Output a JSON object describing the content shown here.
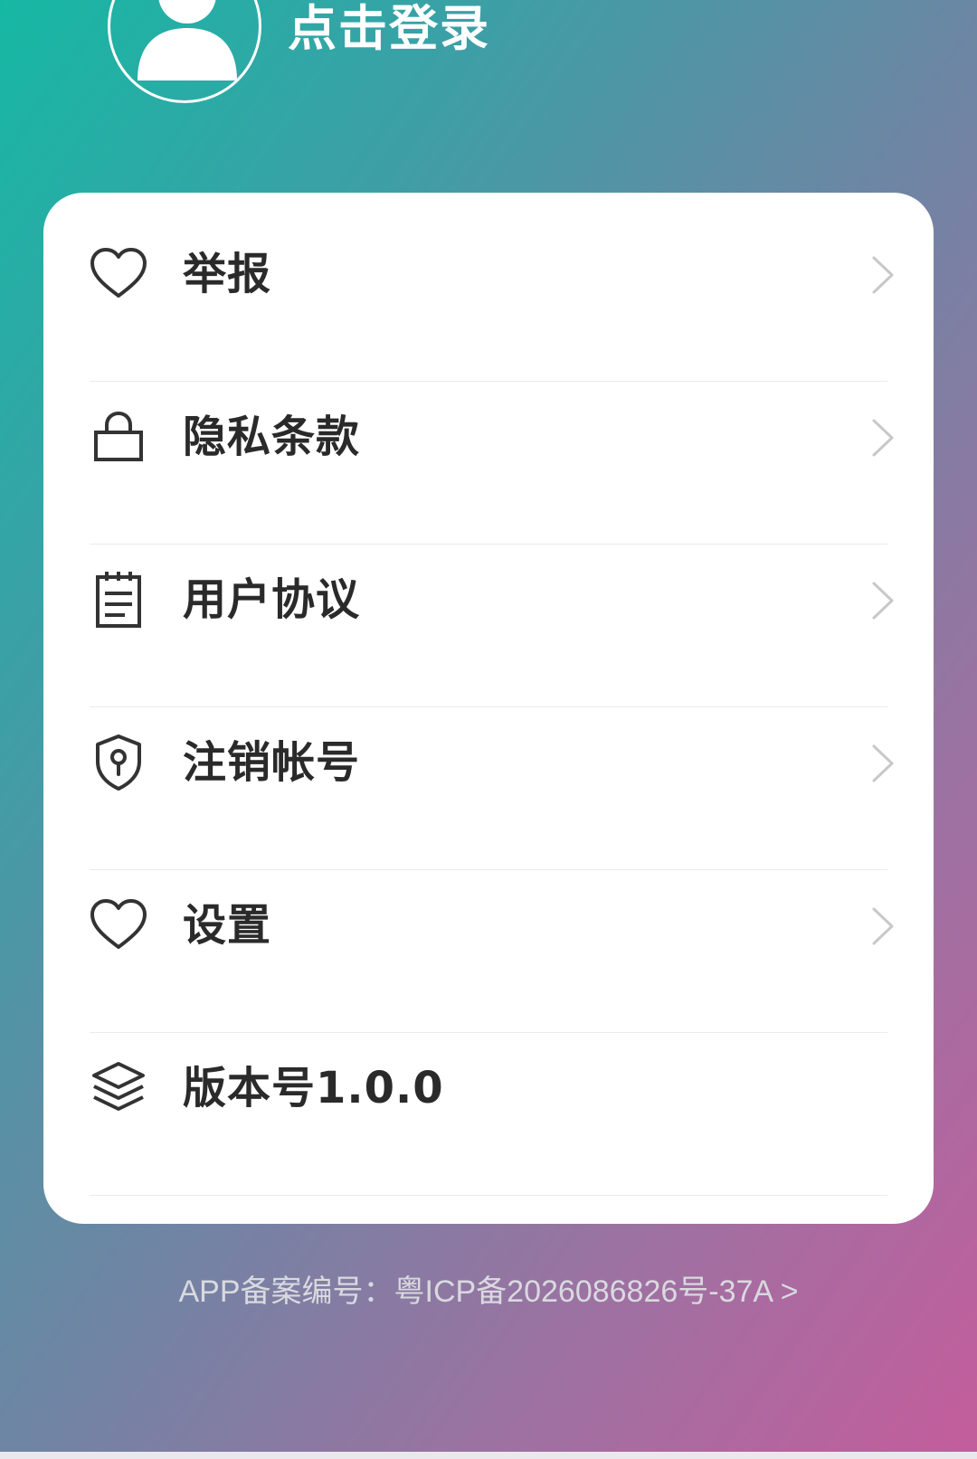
{
  "header": {
    "login_label": "点击登录",
    "avatar_icon": "user-avatar-icon"
  },
  "menu": {
    "items": [
      {
        "label": "举报",
        "icon": "heart-icon",
        "has_arrow": true
      },
      {
        "label": "隐私条款",
        "icon": "lock-icon",
        "has_arrow": true
      },
      {
        "label": "用户协议",
        "icon": "notepad-icon",
        "has_arrow": true
      },
      {
        "label": "注销帐号",
        "icon": "shield-keyhole-icon",
        "has_arrow": true
      },
      {
        "label": "设置",
        "icon": "heart-icon",
        "has_arrow": true
      },
      {
        "label": "版本号1.0.0",
        "icon": "layers-icon",
        "has_arrow": false
      }
    ]
  },
  "footer": {
    "icp_text": "APP备案编号：粤ICP备2026086826号-37A >"
  },
  "colors": {
    "gradient_start": "#16b8a4",
    "gradient_end": "#c45d9c",
    "card_background": "#ffffff",
    "label_text": "#2a2a2a",
    "icon_stroke": "#333333",
    "chevron": "#c8c8c8",
    "footer_text": "#d9d9df"
  }
}
